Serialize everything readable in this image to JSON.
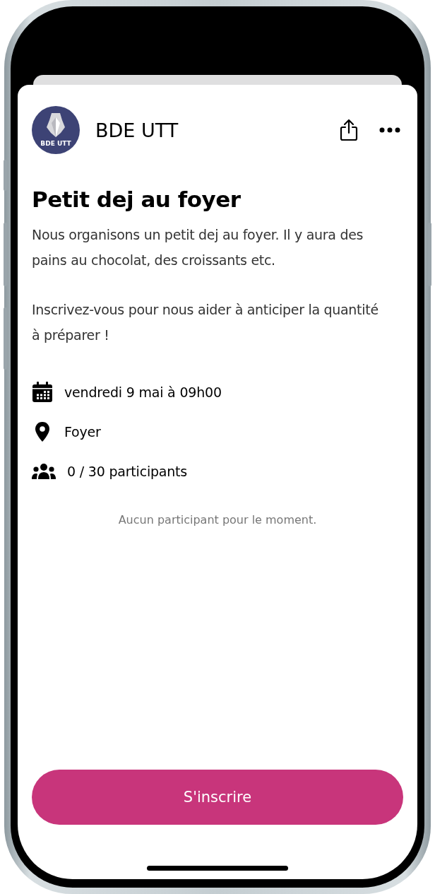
{
  "header": {
    "organizer": "BDE UTT",
    "avatar_label": "BDE UTT"
  },
  "event": {
    "title": "Petit dej au foyer",
    "description": [
      "Nous organisons un petit dej au foyer. Il y aura des pains au chocolat, des croissants etc.",
      "Inscrivez-vous pour nous aider à anticiper la quantité à préparer !"
    ]
  },
  "details": [
    {
      "kind": "date",
      "text": "vendredi 9 mai à 09h00"
    },
    {
      "kind": "place",
      "text": "Foyer"
    },
    {
      "kind": "participants",
      "text": "0 / 30 participants"
    }
  ],
  "participants_empty": "Aucun participant pour le moment.",
  "action_button": "S'inscrire"
}
